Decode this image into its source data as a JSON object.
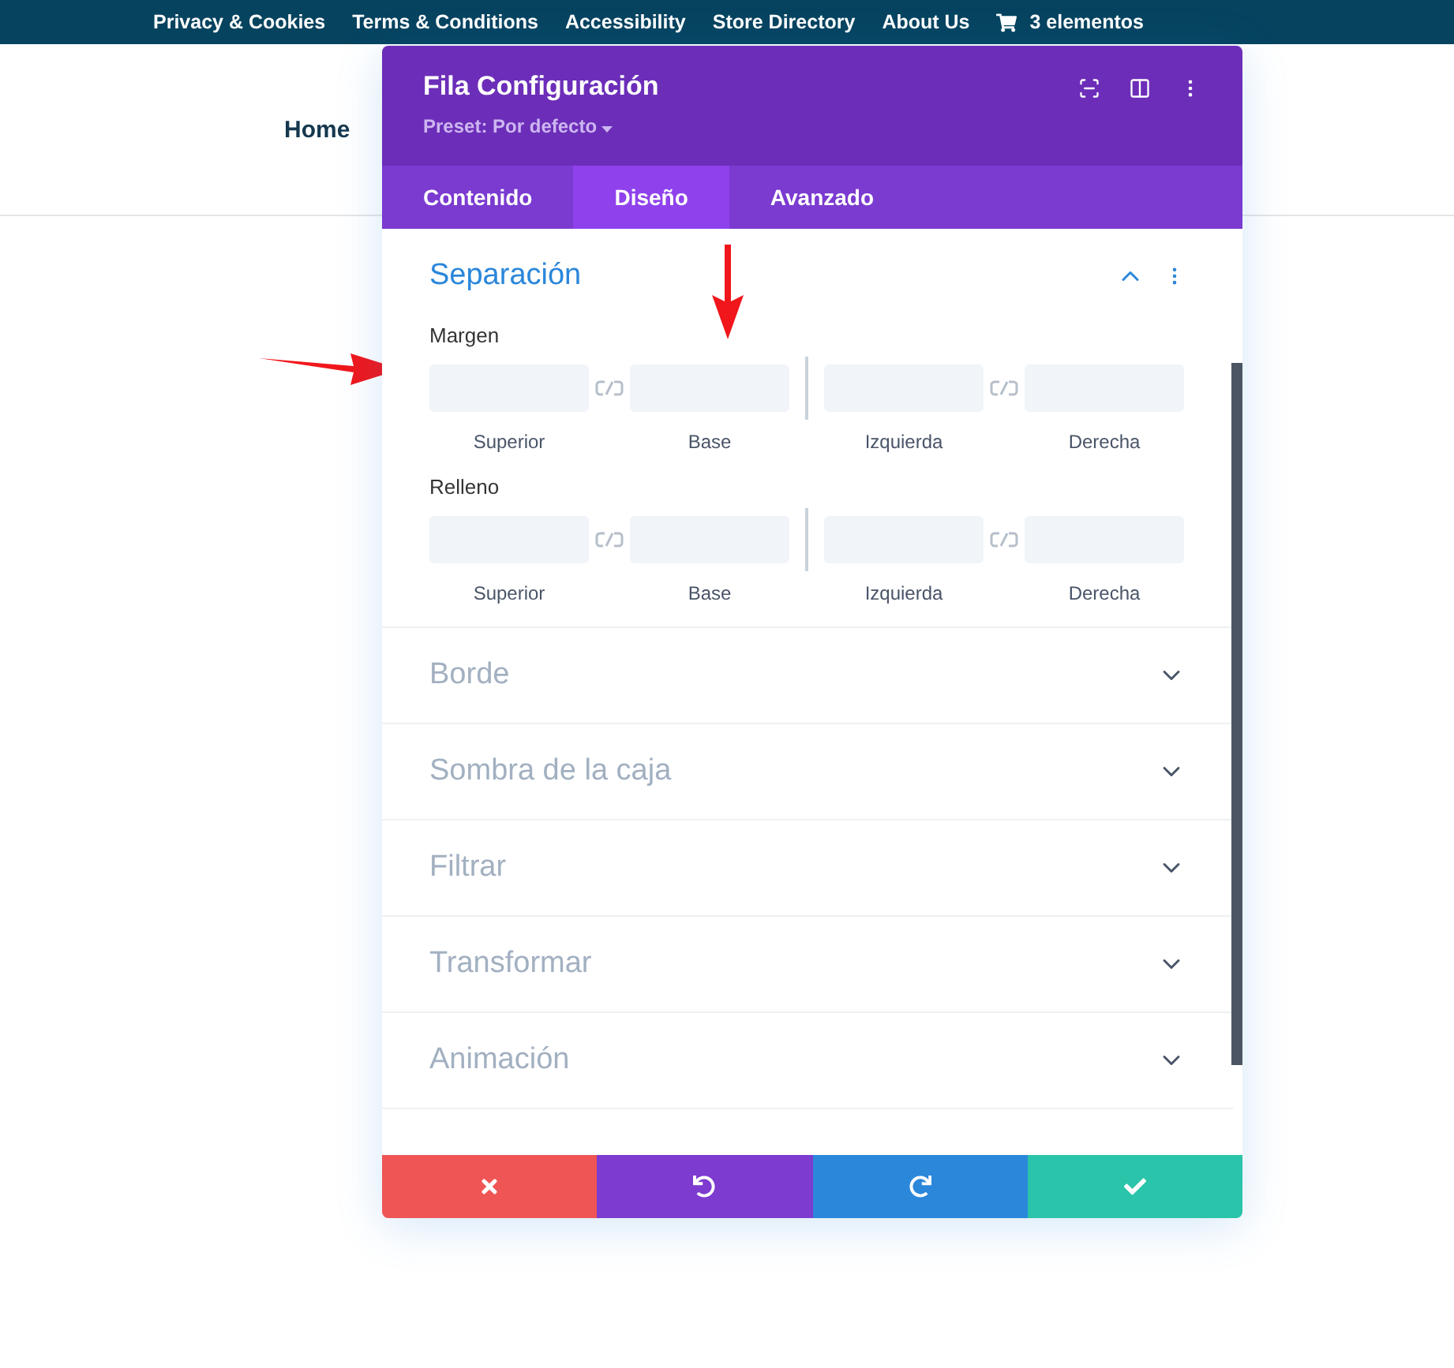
{
  "top_bar": {
    "links": [
      "Privacy & Cookies",
      "Terms & Conditions",
      "Accessibility",
      "Store Directory",
      "About Us"
    ],
    "cart": "3 elementos"
  },
  "site_nav": {
    "items": [
      "Home"
    ]
  },
  "modal": {
    "title": "Fila Configuración",
    "preset": "Preset: Por defecto",
    "tabs": [
      {
        "label": "Contenido",
        "selected": false
      },
      {
        "label": "Diseño",
        "selected": true
      },
      {
        "label": "Avanzado",
        "selected": false
      }
    ],
    "sections": [
      {
        "title": "Separación",
        "expanded": true,
        "groups": [
          {
            "label": "Margen",
            "fields": [
              "Superior",
              "Base",
              "Izquierda",
              "Derecha"
            ]
          },
          {
            "label": "Relleno",
            "fields": [
              "Superior",
              "Base",
              "Izquierda",
              "Derecha"
            ]
          }
        ]
      },
      {
        "title": "Borde",
        "expanded": false
      },
      {
        "title": "Sombra de la caja",
        "expanded": false
      },
      {
        "title": "Filtrar",
        "expanded": false
      },
      {
        "title": "Transformar",
        "expanded": false
      },
      {
        "title": "Animación",
        "expanded": false
      }
    ],
    "actions": [
      {
        "kind": "cancel"
      },
      {
        "kind": "undo"
      },
      {
        "kind": "redo"
      },
      {
        "kind": "save"
      }
    ]
  }
}
